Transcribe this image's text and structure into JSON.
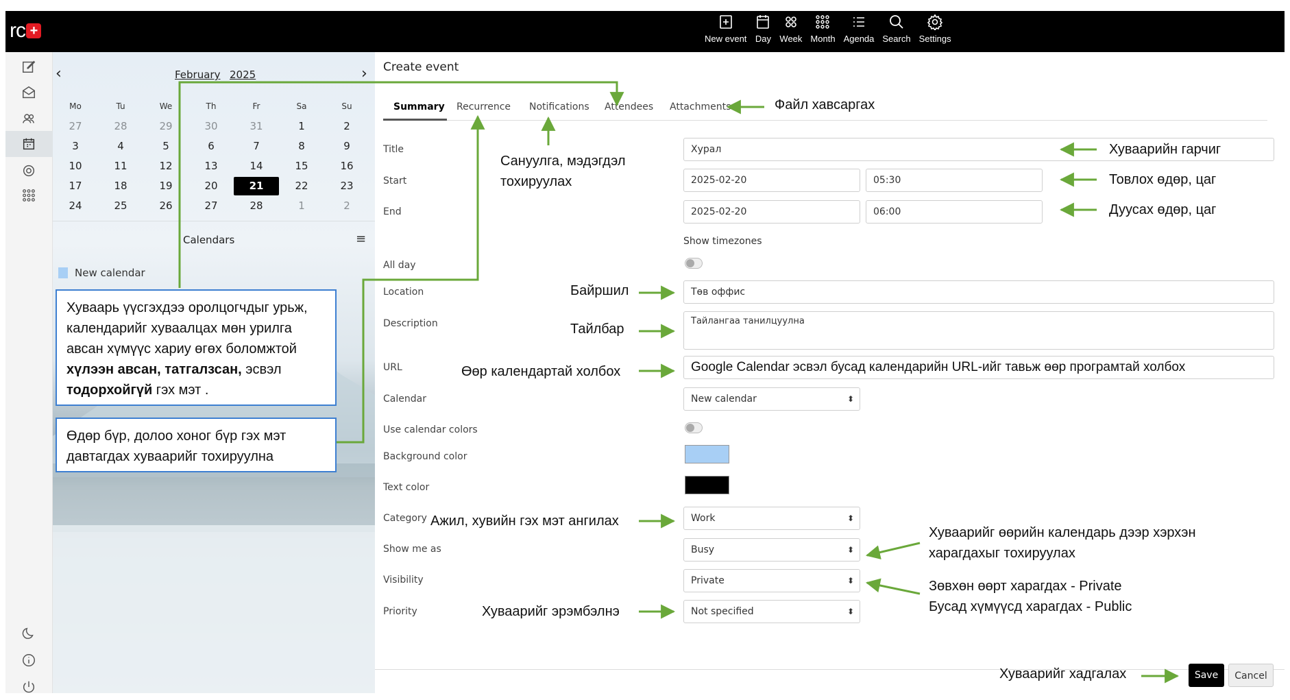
{
  "app": {
    "logo_text": "rc"
  },
  "topnav": [
    {
      "label": "New event",
      "icon": "plus-square-icon"
    },
    {
      "label": "Day",
      "icon": "calendar-icon"
    },
    {
      "label": "Week",
      "icon": "grid4-icon"
    },
    {
      "label": "Month",
      "icon": "grid9-icon"
    },
    {
      "label": "Agenda",
      "icon": "list-icon"
    },
    {
      "label": "Search",
      "icon": "search-icon"
    },
    {
      "label": "Settings",
      "icon": "gear-icon"
    }
  ],
  "rail": [
    "compose-icon",
    "mail-icon",
    "contacts-icon",
    "calendar-icon",
    "settings-icon",
    "apps-icon",
    "moon-icon",
    "info-icon",
    "power-icon"
  ],
  "mini_calendar": {
    "month": "February",
    "year": "2025",
    "prev": "‹",
    "next": "›",
    "weekdays": [
      "Mo",
      "Tu",
      "We",
      "Th",
      "Fr",
      "Sa",
      "Su"
    ],
    "weeks": [
      [
        "27",
        "28",
        "29",
        "30",
        "31",
        "1",
        "2"
      ],
      [
        "3",
        "4",
        "5",
        "6",
        "7",
        "8",
        "9"
      ],
      [
        "10",
        "11",
        "12",
        "13",
        "14",
        "15",
        "16"
      ],
      [
        "17",
        "18",
        "19",
        "20",
        "21",
        "22",
        "23"
      ],
      [
        "24",
        "25",
        "26",
        "27",
        "28",
        "1",
        "2"
      ]
    ],
    "today": "21"
  },
  "calendars": {
    "title": "Calendars",
    "menu": "≡",
    "items": [
      {
        "name": "New calendar",
        "color": "#a8cff5"
      }
    ]
  },
  "notes": {
    "attendees_note": {
      "l1": "Хуваарь үүсгэхдээ оролцогчдыг урьж,",
      "l2": "календарийг хуваалцах мөн урилга",
      "l3": "авсан хүмүүс хариу өгөх боломжтой",
      "l4_bold": "хүлээн авсан, татгалзсан,",
      "l4_rest": " эсвэл",
      "l5_bold": "тодорхойгүй",
      "l5_rest": " гэх мэт ."
    },
    "recurrence_note": {
      "l1": "Өдөр бүр, долоо хоног бүр гэх мэт",
      "l2": "давтагдах хуваарийг тохируулна"
    }
  },
  "form": {
    "header": "Create event",
    "tabs": [
      "Summary",
      "Recurrence",
      "Notifications",
      "Attendees",
      "Attachments"
    ],
    "labels": {
      "title": "Title",
      "start": "Start",
      "end": "End",
      "all_day": "All day",
      "location": "Location",
      "description": "Description",
      "url": "URL",
      "calendar": "Calendar",
      "use_calendar_colors": "Use calendar colors",
      "background_color": "Background color",
      "text_color": "Text color",
      "category": "Category",
      "show_me_as": "Show me as",
      "visibility": "Visibility",
      "priority": "Priority",
      "show_timezones": "Show timezones"
    },
    "values": {
      "title": "Хурал",
      "start_date": "2025-02-20",
      "start_time": "05:30",
      "end_date": "2025-02-20",
      "end_time": "06:00",
      "location": "Төв оффис",
      "description": "Тайлангаа танилцуулна",
      "url": "Google Calendar эсвэл бусад календарийн URL-ийг тавьж өөр програмтай холбох",
      "calendar": "New calendar",
      "category": "Work",
      "show_me_as": "Busy",
      "visibility": "Private",
      "priority": "Not specified"
    },
    "colors": {
      "background": "#a8cff5",
      "text": "#000000"
    },
    "buttons": {
      "save": "Save",
      "cancel": "Cancel"
    }
  },
  "annotations": {
    "attachments": "Файл хавсаргах",
    "notifications_l1": "Сануулга, мэдэгдэл",
    "notifications_l2": "тохируулах",
    "title": "Хуваарийн гарчиг",
    "start": "Товлох өдөр, цаг",
    "end": "Дуусах өдөр, цаг",
    "location": "Байршил",
    "description": "Тайлбар",
    "url": "Өөр календартай холбох",
    "category": "Ажил, хувийн гэх мэт ангилах",
    "show_me_as_l1": "Хуваарийг өөрийн календарь дээр хэрхэн",
    "show_me_as_l2": "харагдахыг тохируулах",
    "visibility_l1": "Зөвхөн өөрт харагдах - Private",
    "visibility_l2": "Бусад хүмүүсд харагдах - Public",
    "priority": "Хуваарийг эрэмбэлнэ",
    "save": "Хуваарийг хадгалах",
    "arrow_color": "#6aa83a"
  }
}
